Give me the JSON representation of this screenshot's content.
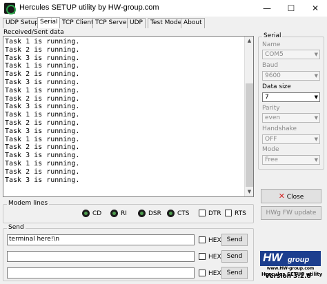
{
  "window": {
    "title": "Hercules SETUP utility by HW-group.com",
    "minimize": "—",
    "maximize": "☐",
    "close": "✕"
  },
  "tabs": [
    "UDP Setup",
    "Serial",
    "TCP Client",
    "TCP Server",
    "UDP",
    "Test Mode",
    "About"
  ],
  "received": {
    "label": "Received/Sent data",
    "lines": [
      "Task 1 is running.",
      "Task 2 is running.",
      "Task 3 is running.",
      "Task 1 is running.",
      "Task 2 is running.",
      "Task 3 is running.",
      "Task 1 is running.",
      "Task 2 is running.",
      "Task 3 is running.",
      "Task 1 is running.",
      "Task 2 is running.",
      "Task 3 is running.",
      "Task 1 is running.",
      "Task 2 is running.",
      "Task 3 is running.",
      "Task 1 is running.",
      "Task 2 is running.",
      "Task 3 is running."
    ]
  },
  "modem": {
    "title": "Modem lines",
    "leds": [
      "CD",
      "RI",
      "DSR",
      "CTS"
    ],
    "checks": [
      "DTR",
      "RTS"
    ]
  },
  "send": {
    "title": "Send",
    "rows": [
      {
        "value": "terminal here!\\n",
        "hex_label": "HEX",
        "button": "Send"
      },
      {
        "value": "",
        "hex_label": "HEX",
        "button": "Send"
      },
      {
        "value": "",
        "hex_label": "HEX",
        "button": "Send"
      }
    ]
  },
  "serial": {
    "title": "Serial",
    "fields": [
      {
        "label": "Name",
        "value": "COM5",
        "enabled": false
      },
      {
        "label": "Baud",
        "value": "9600",
        "enabled": false
      },
      {
        "label": "Data size",
        "value": "7",
        "enabled": true
      },
      {
        "label": "Parity",
        "value": "even",
        "enabled": false
      },
      {
        "label": "Handshake",
        "value": "OFF",
        "enabled": false
      },
      {
        "label": "Mode",
        "value": "Free",
        "enabled": false
      }
    ],
    "close_button": "Close",
    "close_icon": "red-x-icon",
    "fw_button": "HWg FW update"
  },
  "branding": {
    "logo_hw": "HW",
    "logo_group": "group",
    "logo_url": "www.HW-group.com",
    "product": "Hercules SETUP utility",
    "version": "Version  3.2.8"
  },
  "colors": {
    "logo_blue": "#1c3e8e",
    "close_x_red": "#d32020",
    "led_green": "#4d9c4d"
  }
}
